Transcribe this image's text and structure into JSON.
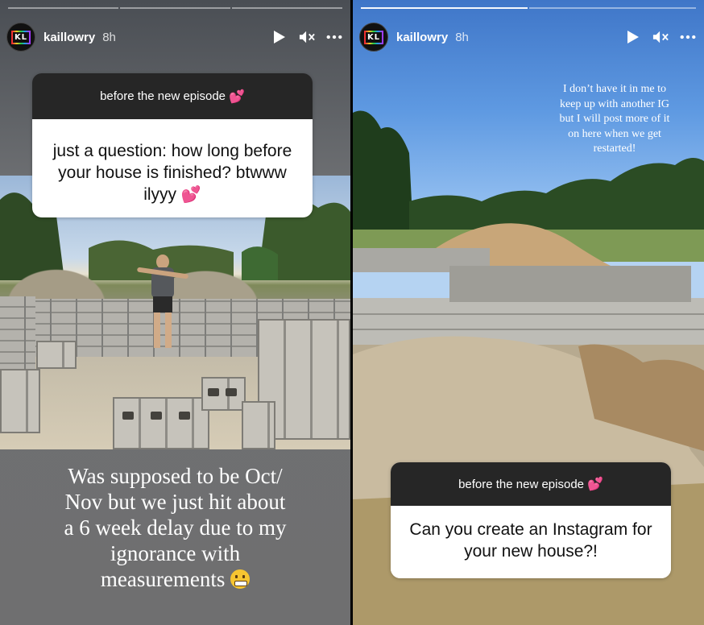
{
  "stories": [
    {
      "progress": {
        "segments": 3,
        "done": 0
      },
      "user": {
        "name": "kaillowry",
        "time": "8h",
        "avatar_text": "KL"
      },
      "controls": [
        "play-icon",
        "mute-icon",
        "more-icon"
      ],
      "question": {
        "header": "before the new episode",
        "header_emoji": "💕",
        "text": "just a question: how long before your house is finished? btwww ilyyy",
        "text_emoji": "💕"
      },
      "caption_lines": [
        "Was supposed to be Oct/",
        "Nov but we just hit about",
        "a 6 week delay due to my",
        "ignorance with",
        "measurements"
      ],
      "caption_emoji": "grimacing-face"
    },
    {
      "progress": {
        "segments": 2,
        "done": 1
      },
      "user": {
        "name": "kaillowry",
        "time": "8h",
        "avatar_text": "KL"
      },
      "controls": [
        "play-icon",
        "mute-icon",
        "more-icon"
      ],
      "caption_lines": [
        "I don’t have it in me to",
        "keep up with another IG",
        "but I will post more of it",
        "on here when we get",
        "restarted!"
      ],
      "question": {
        "header": "before the new episode",
        "header_emoji": "💕",
        "text": "Can you create an Instagram for your new house?!"
      }
    }
  ],
  "colors": {
    "sticker_header": "#262626",
    "heart": "#ff3d8b"
  }
}
